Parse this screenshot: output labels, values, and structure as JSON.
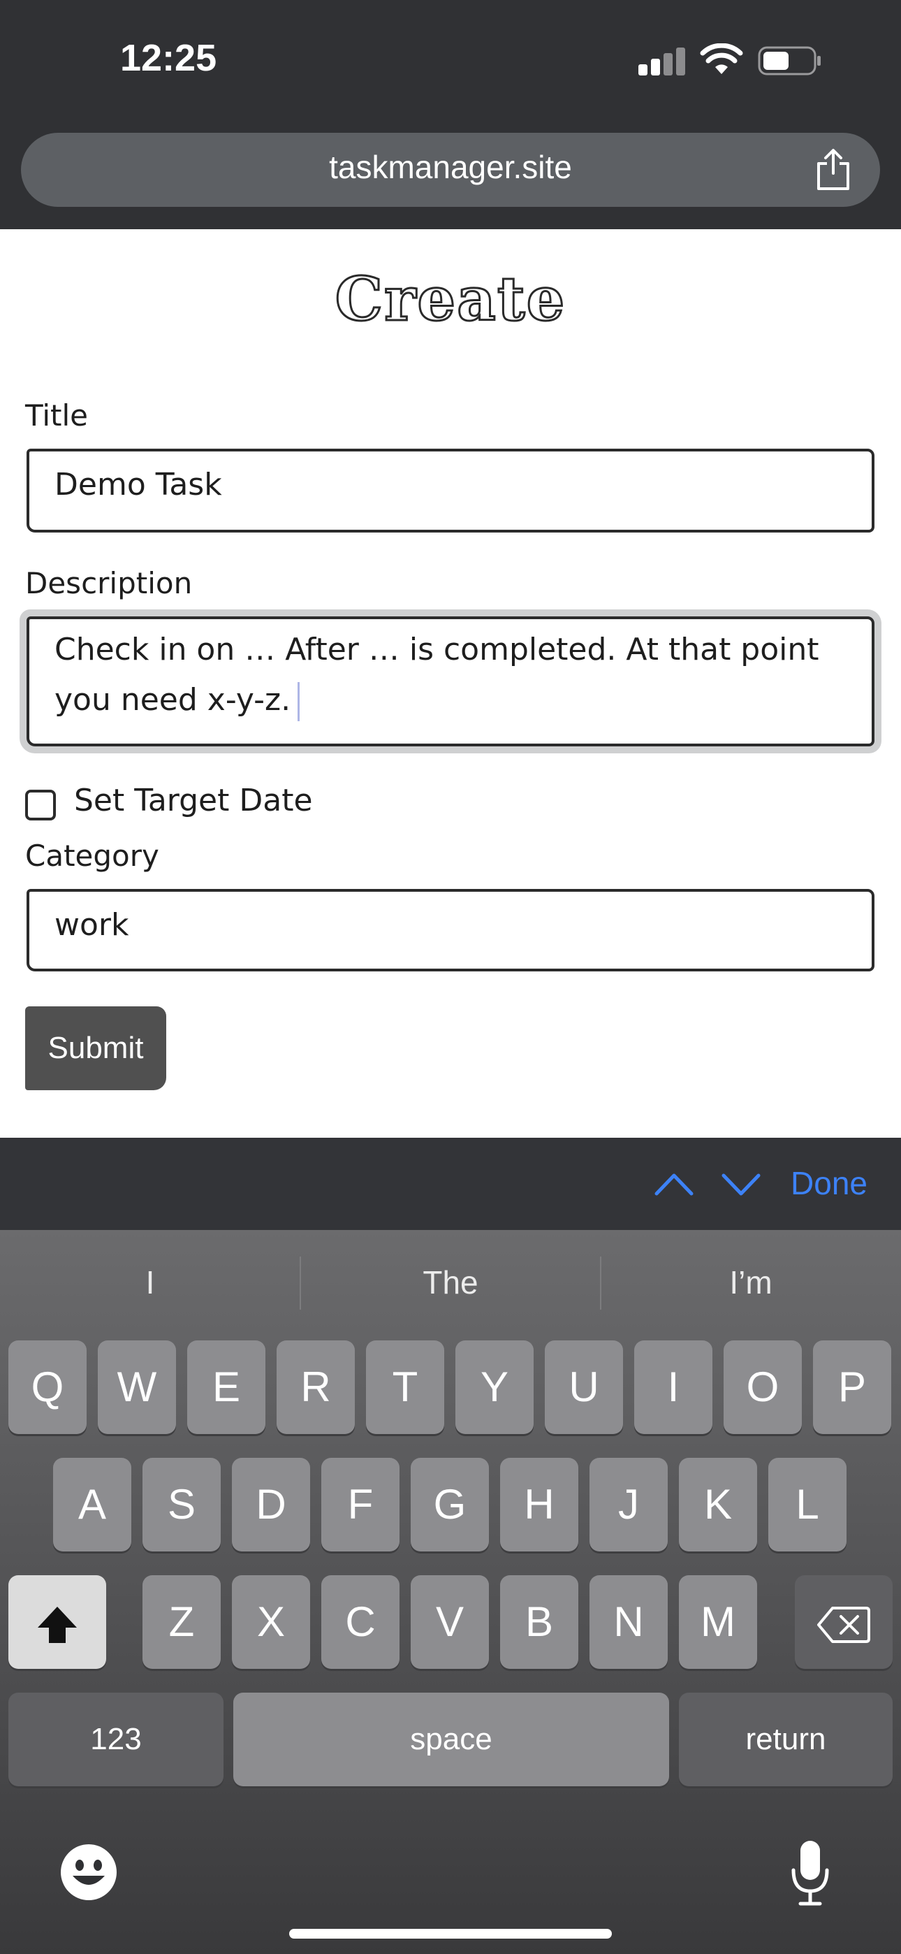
{
  "status_bar": {
    "time": "12:25"
  },
  "browser": {
    "url": "taskmanager.site"
  },
  "page": {
    "title": "Create",
    "form": {
      "title_label": "Title",
      "title_value": "Demo Task",
      "description_label": "Description",
      "description_value": "Check in on … After … is completed.  At that point you need x-y-z.",
      "target_date_label": "Set Target Date",
      "target_date_checked": false,
      "category_label": "Category",
      "category_value": "work",
      "submit_label": "Submit"
    }
  },
  "keyboard_accessory": {
    "done_label": "Done"
  },
  "keyboard": {
    "suggestions": [
      "I",
      "The",
      "I’m"
    ],
    "row1": [
      "Q",
      "W",
      "E",
      "R",
      "T",
      "Y",
      "U",
      "I",
      "O",
      "P"
    ],
    "row2": [
      "A",
      "S",
      "D",
      "F",
      "G",
      "H",
      "J",
      "K",
      "L"
    ],
    "row3": [
      "Z",
      "X",
      "C",
      "V",
      "B",
      "N",
      "M"
    ],
    "numbers_label": "123",
    "space_label": "space",
    "return_label": "return"
  },
  "colors": {
    "accent": "#3d82f7",
    "submit_bg": "#505050",
    "page_bg": "#ffffff"
  }
}
